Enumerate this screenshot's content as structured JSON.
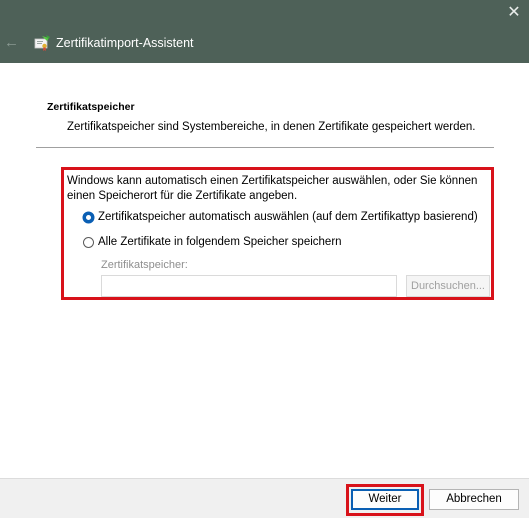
{
  "window": {
    "title": "Zertifikatimport-Assistent",
    "close_glyph": "✕",
    "back_glyph": "←"
  },
  "section": {
    "title": "Zertifikatspeicher",
    "description": "Zertifikatspeicher sind Systembereiche, in denen Zertifikate gespeichert werden."
  },
  "options": {
    "intro": "Windows kann automatisch einen Zertifikatspeicher auswählen, oder Sie können einen Speicherort für die Zertifikate angeben.",
    "auto_label": "Zertifikatspeicher automatisch auswählen (auf dem Zertifikattyp basierend)",
    "auto_selected": true,
    "manual_label": "Alle Zertifikate in folgendem Speicher speichern",
    "manual_selected": false,
    "store_label": "Zertifikatspeicher:",
    "store_value": "",
    "browse_label": "Durchsuchen..."
  },
  "footer": {
    "next_label": "Weiter",
    "cancel_label": "Abbrechen"
  },
  "colors": {
    "titlebar": "#4e6158",
    "highlight": "#d8121a",
    "accent": "#0a5fb4"
  },
  "icons": {
    "wizard": "certificate-wizard-icon",
    "back": "back-arrow-icon",
    "close": "close-icon"
  }
}
